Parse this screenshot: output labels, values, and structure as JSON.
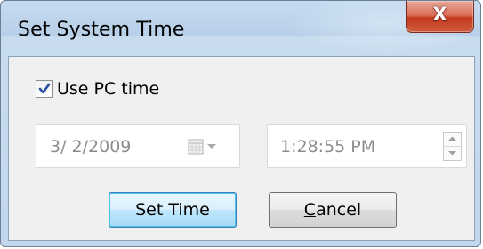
{
  "window": {
    "title": "Set System Time",
    "close_glyph": "X"
  },
  "use_pc_time": {
    "label": "Use PC time",
    "checked": true
  },
  "date_picker": {
    "value": "3/  2/2009",
    "icon": "calendar-dropdown-icon",
    "enabled": false
  },
  "time_picker": {
    "value": "1:28:55 PM",
    "icon": "spinner-icon",
    "enabled": false
  },
  "buttons": {
    "set_time": "Set Time",
    "cancel_first": "C",
    "cancel_rest": "ancel"
  },
  "colors": {
    "frame": "#c2d6ec",
    "client": "#f0f0f0",
    "close_button": "#c43b20",
    "focus_border": "#3c7fb1",
    "disabled_text": "#8c8c8c"
  }
}
